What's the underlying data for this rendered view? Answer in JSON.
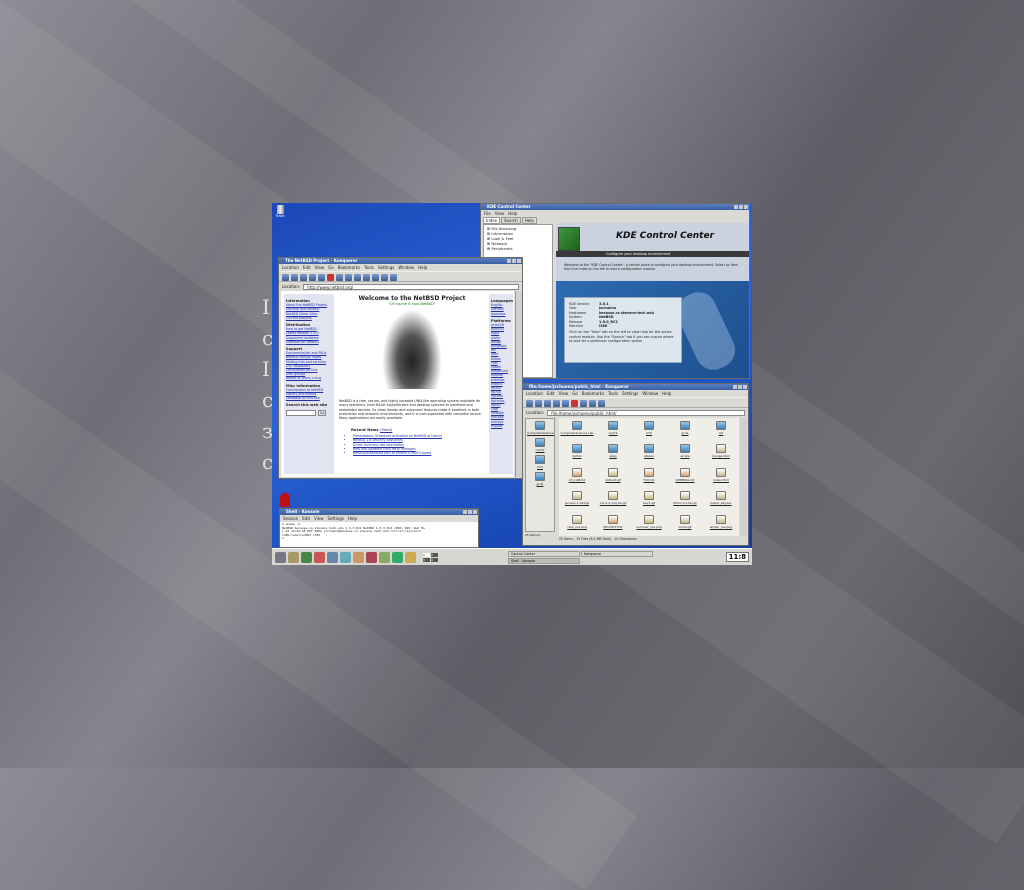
{
  "slide": {
    "partial_text_letters": [
      "I",
      "c",
      "I",
      "c",
      "з",
      "c"
    ]
  },
  "desktop": {
    "trash_label": "Trash"
  },
  "control_center": {
    "title": "KDE Control Center",
    "menu": [
      "File",
      "View",
      "Help"
    ],
    "tabs": [
      "Index",
      "Search",
      "Help"
    ],
    "tree": [
      "File Browsing",
      "Information",
      "Look & Feel",
      "Network",
      "Peripherals"
    ],
    "header_title": "KDE Control Center",
    "header_subtitle": "Configure your desktop environment",
    "welcome": "Welcome to the \"KDE Control Center\", a central place to configure your desktop environment. Select an item from the index on the left to load a configuration module.",
    "info": [
      [
        "KDE version",
        "3.0.1"
      ],
      [
        "User",
        "jschueno"
      ],
      [
        "Hostname",
        "becasse.cs.stevens-tech.edu"
      ],
      [
        "System",
        "NetBSD"
      ],
      [
        "Release",
        "1.6.0_RC2"
      ],
      [
        "Machine",
        "i386"
      ]
    ],
    "help": "Click on the \"Help\" tab on the left to view help for the active control module. Use the \"Search\" tab if you are unsure where to look for a particular configuration option."
  },
  "browser": {
    "title": "The NetBSD Project - Konqueror",
    "menu": [
      "Location",
      "Edit",
      "View",
      "Go",
      "Bookmarks",
      "Tools",
      "Settings",
      "Window",
      "Help"
    ],
    "location_label": "Location:",
    "url": "http://www.netbsd.org/",
    "page_title": "Welcome to the NetBSD Project",
    "tagline": "\"Of course it runs NetBSD\"",
    "left_sections": [
      {
        "heading": "Information",
        "links": [
          "About the NetBSD Project",
          "Security and NetBSD",
          "NetBSD Mirror Sites",
          "Current projects"
        ]
      },
      {
        "heading": "Distribution",
        "links": [
          "How to get NetBSD",
          "Latest release: 1.5.3",
          "Supported hardware",
          "Software for NetBSD"
        ]
      },
      {
        "heading": "Support",
        "links": [
          "Documentation and FAQs",
          "NetBSD Manual Pages",
          "Mailing lists and archives",
          "CVS Repository",
          "Consultants for hire",
          "User groups",
          "Report or query a bug"
        ]
      },
      {
        "heading": "Misc Information",
        "links": [
          "Contributors to NetBSD",
          "Gallery and events",
          "Feedback on this site"
        ]
      },
      {
        "heading": "Search this web site",
        "links": []
      }
    ],
    "search_button": "Go",
    "body_text": "NetBSD is a free, secure, and highly portable UNIX-like operating system available for many platforms, from 64-bit AlphaServers and desktop systems to handheld and embedded devices. Its clean design and advanced features make it excellent in both production and research environments, and it is user-supported with complete source. Many applications are easily available.",
    "news_heading": "Recent News",
    "news_more": "(More)",
    "news": [
      "Presentation: Scheduler activation on NetBSD at Usenix",
      "NetBSD 1.6 Security Advisories",
      "Driver Inventory documentation",
      "New and Updated Third Party Packages",
      "NetBSD/dreamcast port to Hitachi's PROFS board"
    ],
    "right_sections": [
      {
        "heading": "Languages",
        "links": [
          "English",
          "German",
          "Japanese"
        ]
      },
      {
        "heading": "Platforms",
        "links": [
          "acorn26",
          "acorn32",
          "algor",
          "alpha",
          "amiga",
          "amigappc",
          "arc",
          "atari",
          "bebox",
          "cats",
          "cobalt",
          "dreamcast",
          "evbarm",
          "evbmips",
          "evbsh3",
          "hp300",
          "hp700",
          "hpcarm",
          "hpcmips",
          "hpcsh",
          "i386",
          "luna68k",
          "mac68k",
          "macppc",
          "mipsco"
        ]
      }
    ]
  },
  "konsole": {
    "title": "Shell - Konsole",
    "menu": [
      "Session",
      "Edit",
      "View",
      "Settings",
      "Help"
    ],
    "lines": [
      "% uname -a",
      "NetBSD becasse.cs.stevens-tech.edu 1.5.3_RC2 NetBSD 1.5.3_RC2 (BOX) #25: Wed Ma",
      "y 22 19:02:58 EDT 2002  jschueno@becasse.cs.stevens-tech.edu:/usr/src/sys/arch",
      "i386/compile/BOX i386",
      "%"
    ]
  },
  "filemanager": {
    "title": "file:/home/jschueno/public_html - Konqueror",
    "menu": [
      "Location",
      "Edit",
      "View",
      "Go",
      "Bookmarks",
      "Tools",
      "Settings",
      "Window",
      "Help"
    ],
    "location_label": "Location:",
    "url": "file:/home/jschueno/public_html/",
    "tree_items": [
      "ComputerScience.Lab",
      "cs272",
      "CVS",
      "grub"
    ],
    "files": [
      "ComputerScience.Lab",
      "cs272",
      "CVS",
      "grub",
      "old",
      "bofsol",
      "ebpp",
      "efspos",
      "errata",
      "lounge.html",
      "CS_LAB.txt",
      "default.gif",
      "FAQ.txt",
      "GENERAL.txt",
      "index.html",
      "jscreen-1.09.tgz",
      "mv-1.2.orig.tar.gz",
      "key1.gif",
      "Mimir-0.1.tar.gz",
      "public_key.asc",
      "rash_me.png",
      "SECURITY.txt",
      "summer_me.png",
      "vmail.gif",
      "winter_me.png"
    ],
    "tree_status": "25 Item(s)",
    "status": "25 Items - 15 Files (6.4 MB Total) - 10 Directories"
  },
  "taskbar": {
    "tasks": [
      "Control Center",
      "Konqueror",
      "Shell - Konsole"
    ],
    "desktops": [
      "1",
      "2",
      "3",
      "4"
    ],
    "clock": "11:8"
  }
}
